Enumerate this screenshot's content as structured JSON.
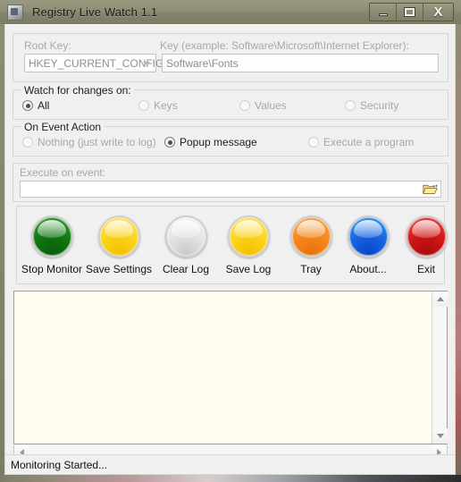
{
  "window": {
    "title": "Registry Live Watch 1.1",
    "icon": "app-icon",
    "buttons": {
      "minimize": "minimize",
      "maximize": "maximize",
      "close": "X"
    }
  },
  "keys_section": {
    "root_key_label": "Root Key:",
    "root_key_value": "HKEY_CURRENT_CONFIG",
    "root_key_options": [
      "HKEY_CURRENT_CONFIG"
    ],
    "key_label": "Key (example: Software\\Microsoft\\Internet Explorer):",
    "key_value": "Software\\Fonts"
  },
  "watch_section": {
    "legend": "Watch for changes on:",
    "options": [
      {
        "label": "All",
        "checked": true,
        "enabled": true
      },
      {
        "label": "Keys",
        "checked": false,
        "enabled": false
      },
      {
        "label": "Values",
        "checked": false,
        "enabled": false
      },
      {
        "label": "Security",
        "checked": false,
        "enabled": false
      }
    ]
  },
  "event_section": {
    "legend": "On Event Action",
    "options": [
      {
        "label": "Nothing (just write to log)",
        "checked": false,
        "enabled": false
      },
      {
        "label": "Popup message",
        "checked": true,
        "enabled": true
      },
      {
        "label": "Execute a program",
        "checked": false,
        "enabled": false
      }
    ]
  },
  "exec_section": {
    "label": "Execute on event:",
    "value": "",
    "placeholder": "",
    "browse_icon": "open-folder-icon"
  },
  "buttons": [
    {
      "label": "Stop Monitor",
      "color": "green",
      "hex": "#0f7310"
    },
    {
      "label": "Save Settings",
      "color": "yellow",
      "hex": "#fcd21a"
    },
    {
      "label": "Clear Log",
      "color": "silver",
      "hex": "#e2e2e2"
    },
    {
      "label": "Save Log",
      "color": "yellow",
      "hex": "#fcd21a"
    },
    {
      "label": "Tray",
      "color": "orange",
      "hex": "#f5861c"
    },
    {
      "label": "About...",
      "color": "blue",
      "hex": "#1560e0"
    },
    {
      "label": "Exit",
      "color": "red",
      "hex": "#cc1414"
    }
  ],
  "log": {
    "text": "",
    "background": "#fffdf0"
  },
  "statusbar": {
    "text": "Monitoring Started..."
  }
}
